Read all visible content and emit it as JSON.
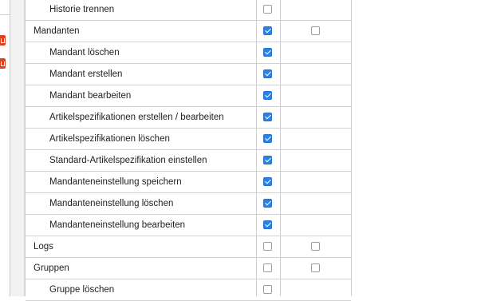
{
  "permissions": [
    {
      "label": "Historie trennen",
      "level": "child",
      "col1": false,
      "col2": null
    },
    {
      "label": "Mandanten",
      "level": "parent",
      "col1": true,
      "col2": false
    },
    {
      "label": "Mandant löschen",
      "level": "child",
      "col1": true,
      "col2": null
    },
    {
      "label": "Mandant erstellen",
      "level": "child",
      "col1": true,
      "col2": null
    },
    {
      "label": "Mandant bearbeiten",
      "level": "child",
      "col1": true,
      "col2": null
    },
    {
      "label": "Artikelspezifikationen erstellen / bearbeiten",
      "level": "child",
      "col1": true,
      "col2": null
    },
    {
      "label": "Artikelspezifikationen löschen",
      "level": "child",
      "col1": true,
      "col2": null
    },
    {
      "label": "Standard-Artikelspezifikation einstellen",
      "level": "child",
      "col1": true,
      "col2": null
    },
    {
      "label": "Mandanteneinstellung speichern",
      "level": "child",
      "col1": true,
      "col2": null
    },
    {
      "label": "Mandanteneinstellung löschen",
      "level": "child",
      "col1": true,
      "col2": null
    },
    {
      "label": "Mandanteneinstellung bearbeiten",
      "level": "child",
      "col1": true,
      "col2": null
    },
    {
      "label": "Logs",
      "level": "parent",
      "col1": false,
      "col2": false
    },
    {
      "label": "Gruppen",
      "level": "parent",
      "col1": false,
      "col2": false
    },
    {
      "label": "Gruppe löschen",
      "level": "child",
      "col1": false,
      "col2": null
    }
  ],
  "left_panel": {
    "icons": [
      "delete-icon",
      "delete-icon"
    ]
  },
  "colors": {
    "checkbox_checked": "#2a82e4",
    "delete_button": "#d9431e",
    "border": "#d2d2d2"
  }
}
